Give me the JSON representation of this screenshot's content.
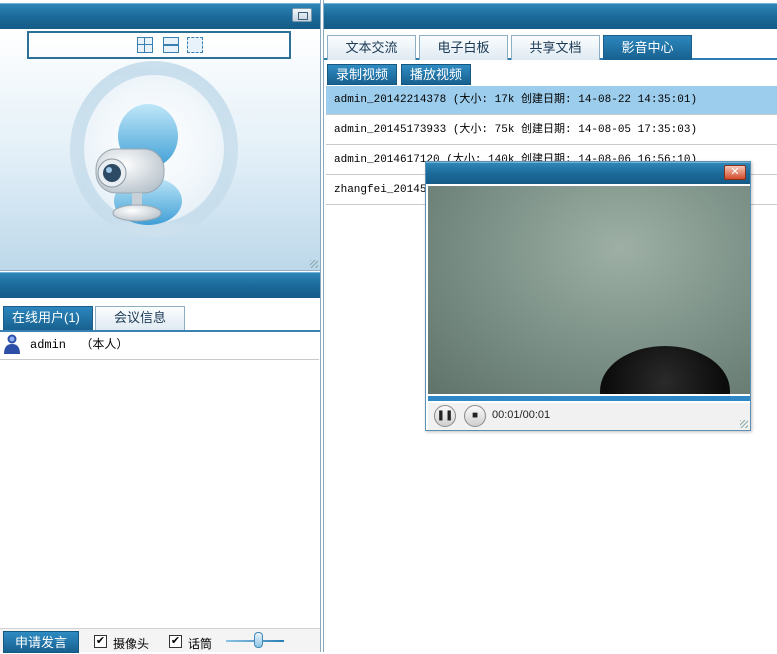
{
  "left_panel": {
    "users_tabs": [
      "在线用户(1)",
      "会议信息"
    ],
    "users": [
      {
        "name": "admin",
        "note": "（本人）"
      }
    ],
    "bottom": {
      "apply_label": "申请发言",
      "camera_label": "摄像头",
      "camera_checked": true,
      "mic_label": "话筒",
      "mic_checked": true
    }
  },
  "right_panel": {
    "tabs": [
      "文本交流",
      "电子白板",
      "共享文档",
      "影音中心"
    ],
    "active_tab": 3,
    "toolbar": {
      "record_label": "录制视频",
      "play_label": "播放视频"
    },
    "files": [
      {
        "text": "admin_20142214378    (大小: 17k   创建日期: 14-08-22 14:35:01)"
      },
      {
        "text": "admin_20145173933    (大小: 75k   创建日期: 14-08-05 17:35:03)"
      },
      {
        "text": "admin_2014617120    (大小: 140k  创建日期: 14-08-06 16:56:10)"
      },
      {
        "text": "zhangfei_2014517"
      }
    ]
  },
  "player": {
    "time": "00:01/00:01",
    "progress": 1.0,
    "close_symbol": "✕"
  },
  "colors": {
    "accent": "#1b6a9a",
    "selected_row": "#9ccdec"
  }
}
